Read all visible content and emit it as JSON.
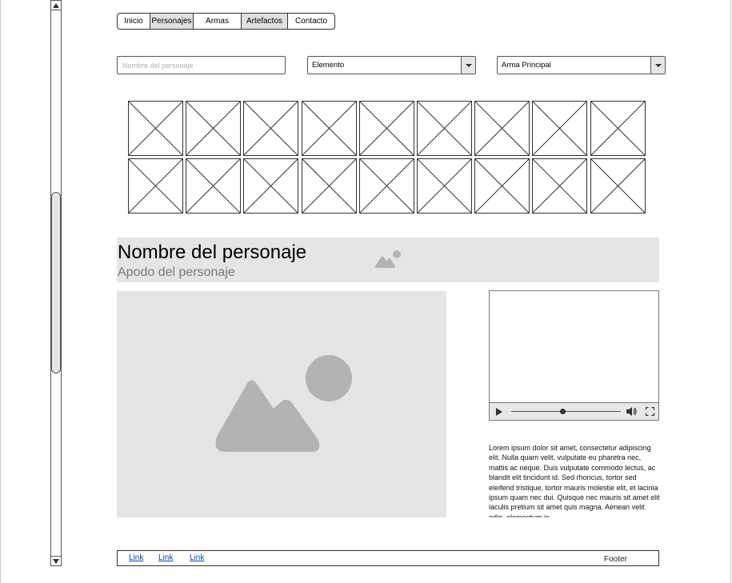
{
  "nav": {
    "tabs": [
      {
        "label": "Inicio",
        "active": false
      },
      {
        "label": "Personajes",
        "active": true
      },
      {
        "label": "Armas",
        "active": false
      },
      {
        "label": "Artefactos",
        "active": true
      },
      {
        "label": "Contacto",
        "active": false
      }
    ]
  },
  "filters": {
    "name_placeholder": "Nombre del personaje",
    "element_select": "Elemento",
    "weapon_select": "Arma Principal"
  },
  "character": {
    "name": "Nombre del personaje",
    "nickname": "Apodo del personaje",
    "description": "Lorem ipsum dolor sit amet, consectetur adipiscing elit. Nulla quam velit, vulputate eu pharetra nec, mattis ac neque. Duis vulputate commodo lectus, ac blandit elit tincidunt id. Sed rhoncus, tortor sed eleifend tristique, tortor mauris molestie elit, et lacinia ipsum quam nec dui. Quisque nec mauris sit amet elit iaculis pretium sit amet quis magna. Aenean velit odio, elementum in"
  },
  "video": {
    "progress": 0.47
  },
  "footer": {
    "links": [
      "Link",
      "Link",
      "Link"
    ],
    "label": "Footer"
  },
  "colors": {
    "placeholder_bg": "#e5e5e5",
    "placeholder_icon": "#b3b3b3",
    "link": "#0645ad",
    "active_tab": "#e0e0e0"
  },
  "icons": [
    "image-placeholder-icon",
    "play-icon",
    "volume-icon",
    "fullscreen-icon",
    "caret-down-icon",
    "scroll-up-icon",
    "scroll-down-icon"
  ]
}
